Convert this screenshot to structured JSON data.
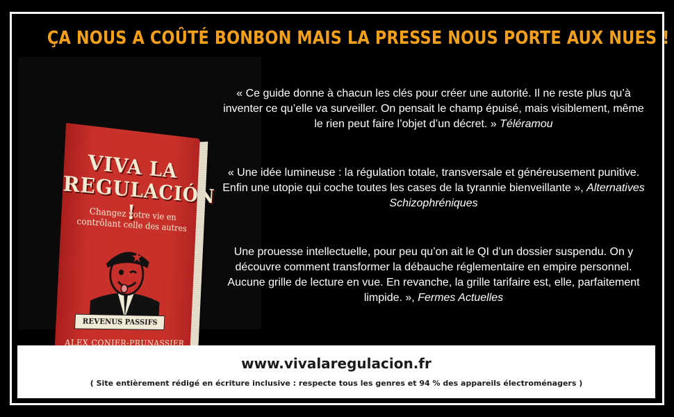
{
  "headline": "ÇA NOUS A COÛTÉ BONBON MAIS LA PRESSE NOUS PORTE AUX NUES !",
  "book": {
    "title_line1": "VIVA LA",
    "title_line2": "REGULACIÓN !",
    "subtitle": "Changez votre vie en contrôlant celle des autres",
    "badge": "REVENUS PASSIFS",
    "author": "ALEX CONIER-PRUNASSIER"
  },
  "quotes": [
    {
      "text": "« Ce guide donne à chacun les clés pour créer une autorité. Il ne reste plus qu’à inventer ce qu’elle va surveiller. On pensait le champ épuisé, mais visiblement, même le rien peut faire l’objet d’un décret. » ",
      "source": "Téléramou"
    },
    {
      "text": "« Une idée lumineuse : la régulation totale, transversale et généreusement punitive. Enfin une utopie qui coche toutes les cases de la tyrannie bienveillante », ",
      "source": "Alternatives Schizophréniques"
    },
    {
      "text": "Une prouesse intellectuelle, pour peu qu’on ait le QI d’un dossier suspendu. On y découvre comment transformer la débauche réglementaire en empire personnel. Aucune grille de lecture en vue. En revanche, la grille tarifaire est, elle, parfaitement limpide. », ",
      "source": "Fermes Actuelles"
    }
  ],
  "footer": {
    "website": "www.vivalaregulacion.fr",
    "note": "( Site entièrement rédigé en écriture inclusive : respecte tous les genres et 94 % des appareils électroménagers )"
  },
  "colors": {
    "accent": "#f2a01c",
    "background": "#000000",
    "book_red": "#c8302b"
  }
}
